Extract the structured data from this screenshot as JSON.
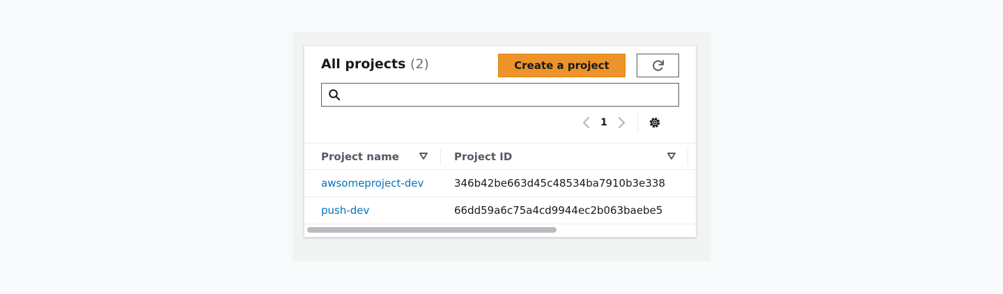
{
  "panel": {
    "title": "All projects",
    "count": "(2)",
    "create_button_label": "Create a project",
    "accent_color": "#ec9329",
    "link_color": "#0073bb"
  },
  "search": {
    "value": "",
    "placeholder": "",
    "icon": "search-icon"
  },
  "pagination": {
    "current_page": "1",
    "prev_icon": "chevron-left-icon",
    "next_icon": "chevron-right-icon",
    "settings_icon": "gear-icon"
  },
  "table": {
    "columns": [
      {
        "label": "Project name",
        "sort_icon": "sort-down-icon"
      },
      {
        "label": "Project ID",
        "sort_icon": "sort-down-icon"
      }
    ],
    "rows": [
      {
        "name": "awsomeproject-dev",
        "id": "346b42be663d45c48534ba7910b3e338"
      },
      {
        "name": "push-dev",
        "id": "66dd59a6c75a4cd9944ec2b063baebe5"
      }
    ]
  }
}
